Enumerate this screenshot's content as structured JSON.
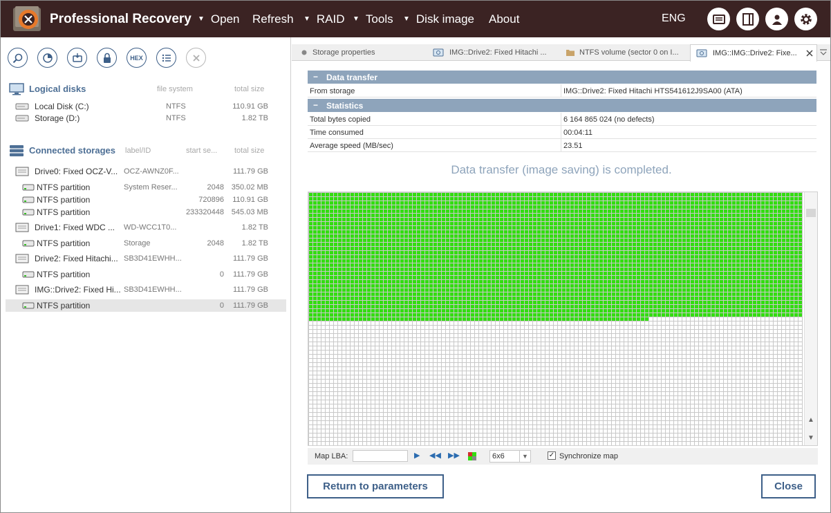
{
  "app": {
    "title": "Professional Recovery",
    "menu": [
      {
        "label": "Open",
        "has_arrow": true
      },
      {
        "label": "Refresh",
        "has_arrow": false
      },
      {
        "label": "RAID",
        "has_arrow": true
      },
      {
        "label": "Tools",
        "has_arrow": true
      },
      {
        "label": "Disk image",
        "has_arrow": true
      },
      {
        "label": "About",
        "has_arrow": false
      }
    ],
    "language": "ENG",
    "colors": {
      "topbar": "#3b2323",
      "accent": "#3d5f88",
      "header_blue": "#8ea4bb",
      "map_used": "#33dd11"
    }
  },
  "toolbar": {
    "hex_label": "HEX",
    "icons": [
      "search-icon",
      "partition-scan-icon",
      "image-file-icon",
      "lock-icon",
      "hex-icon",
      "list-icon",
      "close-icon"
    ]
  },
  "logical": {
    "title": "Logical disks",
    "col_fs": "file system",
    "col_size": "total size",
    "items": [
      {
        "name": "Local Disk (C:)",
        "fs": "NTFS",
        "size": "110.91 GB"
      },
      {
        "name": "Storage (D:)",
        "fs": "NTFS",
        "size": "1.82 TB"
      }
    ]
  },
  "connected": {
    "title": "Connected storages",
    "col_label": "label/ID",
    "col_start": "start se...",
    "col_size": "total size",
    "items": [
      {
        "type": "drive",
        "name": "Drive0: Fixed OCZ-V...",
        "label": "OCZ-AWNZ0F...",
        "start": "",
        "size": "111.79 GB"
      },
      {
        "type": "part",
        "name": "NTFS partition",
        "label": "System Reser...",
        "start": "2048",
        "size": "350.02 MB"
      },
      {
        "type": "part",
        "name": "NTFS partition",
        "label": "",
        "start": "720896",
        "size": "110.91 GB"
      },
      {
        "type": "part",
        "name": "NTFS partition",
        "label": "",
        "start": "233320448",
        "size": "545.03 MB"
      },
      {
        "type": "drive",
        "name": "Drive1: Fixed WDC ...",
        "label": "WD-WCC1T0...",
        "start": "",
        "size": "1.82 TB"
      },
      {
        "type": "part",
        "name": "NTFS partition",
        "label": "Storage",
        "start": "2048",
        "size": "1.82 TB"
      },
      {
        "type": "drive",
        "name": "Drive2: Fixed Hitachi...",
        "label": "SB3D41EWHH...",
        "start": "",
        "size": "111.79 GB"
      },
      {
        "type": "part",
        "name": "NTFS partition",
        "label": "",
        "start": "0",
        "size": "111.79 GB"
      },
      {
        "type": "drive",
        "name": "IMG::Drive2: Fixed Hi...",
        "label": "SB3D41EWHH...",
        "start": "",
        "size": "111.79 GB"
      },
      {
        "type": "part",
        "name": "NTFS partition",
        "label": "",
        "start": "0",
        "size": "111.79 GB",
        "selected": true
      }
    ]
  },
  "tabs": [
    {
      "label": "Storage properties"
    },
    {
      "label": "IMG::Drive2: Fixed Hitachi ..."
    },
    {
      "label": "NTFS volume (sector 0 on I..."
    },
    {
      "label": "IMG::IMG::Drive2: Fixe...",
      "active": true
    }
  ],
  "transfer": {
    "section1": "Data transfer",
    "from_key": "From storage",
    "from_val": "IMG::Drive2: Fixed Hitachi HTS541612J9SA00 (ATA)",
    "section2": "Statistics",
    "stats": [
      {
        "key": "Total bytes copied",
        "value": "6 164 865 024 (no defects)"
      },
      {
        "key": "Time consumed",
        "value": "00:04:11"
      },
      {
        "key": "Average speed (MB/sec)",
        "value": "23.51"
      }
    ],
    "message": "Data transfer (image saving) is completed."
  },
  "map": {
    "rows_filled": 30,
    "partial_cols": 82,
    "lba_label": "Map LBA:",
    "lba_value": "",
    "block_size": "6x6",
    "sync_label": "Synchronize map",
    "sync_checked": true
  },
  "buttons": {
    "return": "Return to parameters",
    "close": "Close"
  }
}
